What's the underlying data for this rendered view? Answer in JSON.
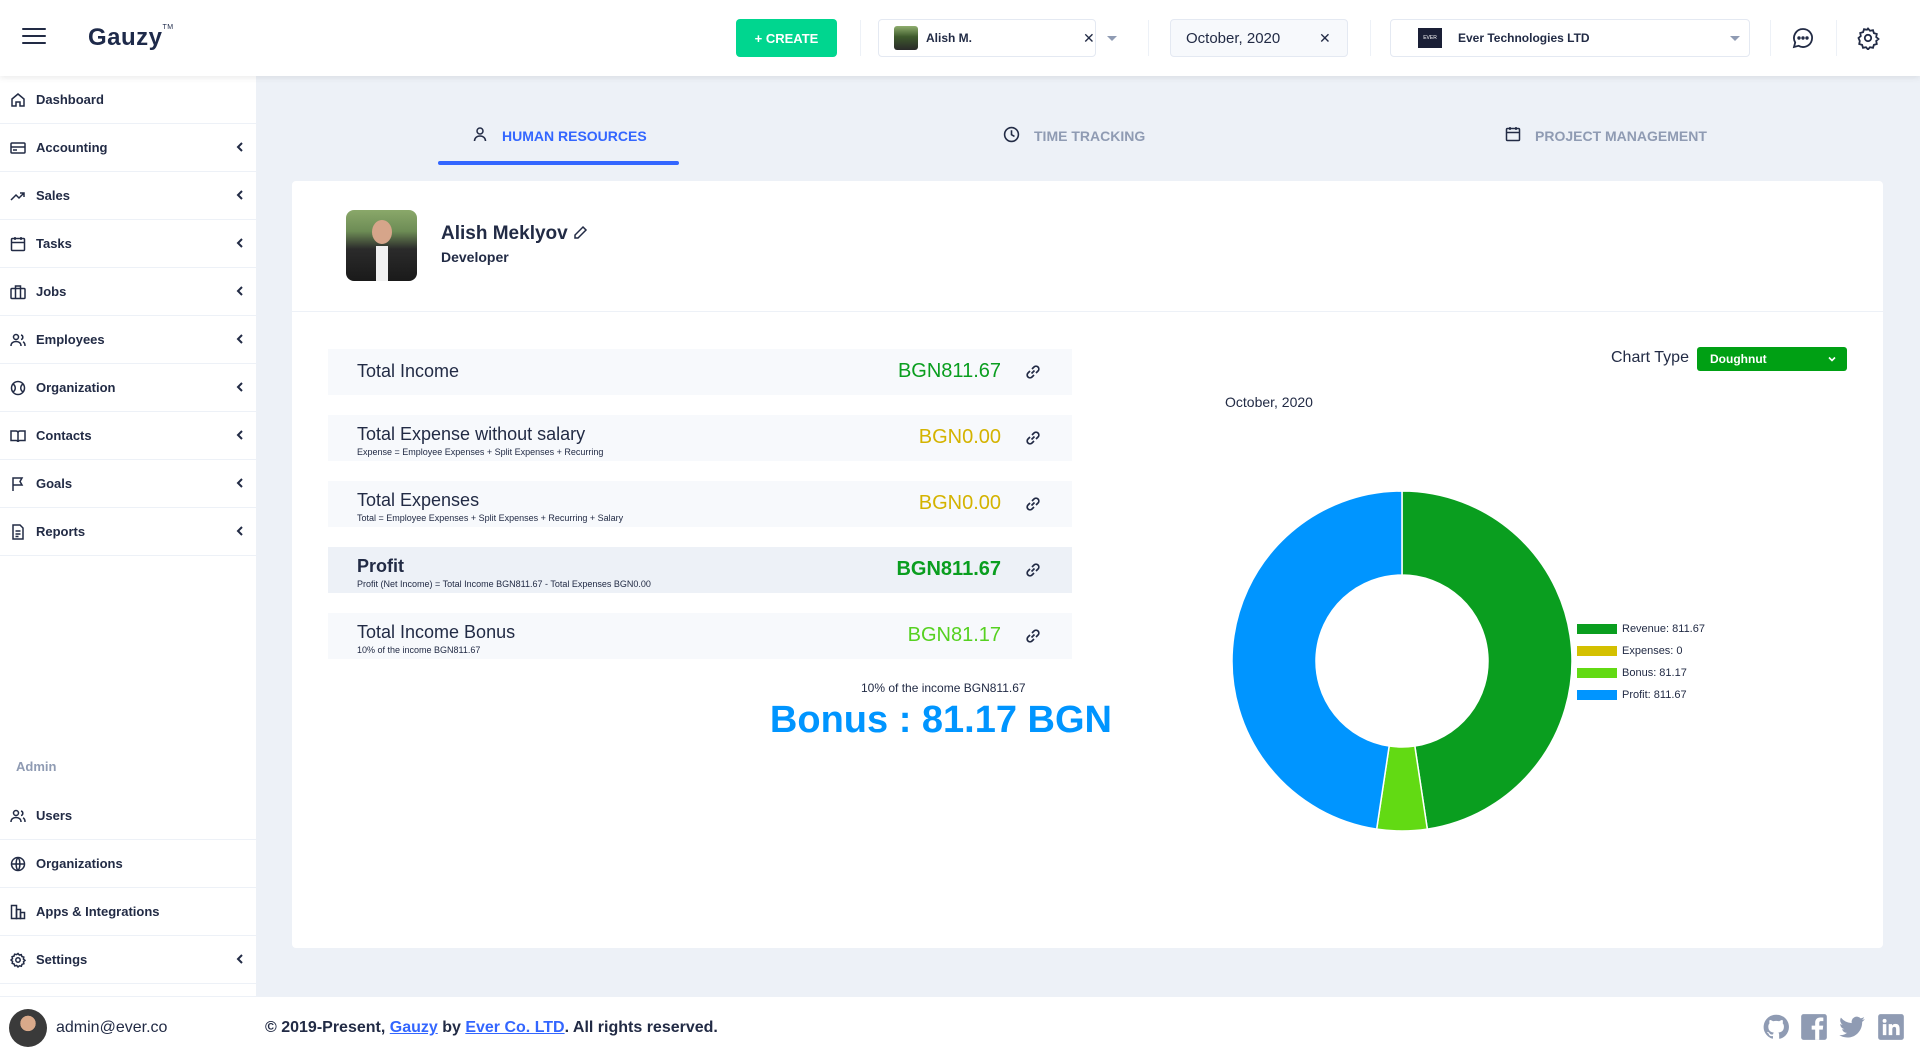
{
  "header": {
    "logo": "Gauzy",
    "logo_tm": "TM",
    "create_label": "+ CREATE",
    "employee": "Alish M.",
    "date": "October, 2020",
    "organization": "Ever Technologies LTD",
    "org_logo_text": "EVER"
  },
  "sidebar": {
    "items": [
      {
        "label": "Dashboard",
        "icon": "home-icon",
        "has_children": false
      },
      {
        "label": "Accounting",
        "icon": "credit-card-icon",
        "has_children": true
      },
      {
        "label": "Sales",
        "icon": "trending-up-icon",
        "has_children": true
      },
      {
        "label": "Tasks",
        "icon": "calendar-icon",
        "has_children": true
      },
      {
        "label": "Jobs",
        "icon": "briefcase-icon",
        "has_children": true
      },
      {
        "label": "Employees",
        "icon": "people-icon",
        "has_children": true
      },
      {
        "label": "Organization",
        "icon": "globe-icon",
        "has_children": true
      },
      {
        "label": "Contacts",
        "icon": "book-icon",
        "has_children": true
      },
      {
        "label": "Goals",
        "icon": "flag-icon",
        "has_children": true
      },
      {
        "label": "Reports",
        "icon": "file-text-icon",
        "has_children": true
      }
    ],
    "admin_label": "Admin",
    "admin_items": [
      {
        "label": "Users",
        "icon": "people-icon",
        "has_children": false
      },
      {
        "label": "Organizations",
        "icon": "globe-icon",
        "has_children": false
      },
      {
        "label": "Apps & Integrations",
        "icon": "layers-icon",
        "has_children": false
      },
      {
        "label": "Settings",
        "icon": "settings-icon",
        "has_children": true
      }
    ]
  },
  "tabs": [
    {
      "label": "HUMAN RESOURCES",
      "icon": "person-icon",
      "active": true
    },
    {
      "label": "TIME TRACKING",
      "icon": "clock-icon",
      "active": false
    },
    {
      "label": "PROJECT MANAGEMENT",
      "icon": "calendar-icon",
      "active": false
    }
  ],
  "profile": {
    "name": "Alish Meklyov",
    "role": "Developer"
  },
  "stats": [
    {
      "title": "Total Income",
      "subtitle": "",
      "value": "BGN811.67",
      "color": "#0a9e1f",
      "bold": false
    },
    {
      "title": "Total Expense without salary",
      "subtitle": "Expense = Employee Expenses + Split Expenses + Recurring",
      "value": "BGN0.00",
      "color": "#d4b300",
      "bold": false
    },
    {
      "title": "Total Expenses",
      "subtitle": "Total = Employee Expenses + Split Expenses + Recurring + Salary",
      "value": "BGN0.00",
      "color": "#d4b300",
      "bold": false
    },
    {
      "title": "Profit",
      "subtitle": "Profit (Net Income) = Total Income BGN811.67 - Total Expenses BGN0.00",
      "value": "BGN811.67",
      "color": "#0a9e1f",
      "bold": true
    },
    {
      "title": "Total Income Bonus",
      "subtitle": "10% of the income BGN811.67",
      "value": "BGN81.17",
      "color": "#56d121",
      "bold": false
    }
  ],
  "bonus": {
    "note": "10% of the income BGN811.67",
    "headline": "Bonus : 81.17 BGN"
  },
  "chart_controls": {
    "label": "Chart Type",
    "selected": "Doughnut"
  },
  "chart_data": {
    "type": "doughnut",
    "title": "October, 2020",
    "series": [
      {
        "name": "Revenue",
        "value": 811.67,
        "color": "#0a9e1f"
      },
      {
        "name": "Expenses",
        "value": 0,
        "color": "#d4c000"
      },
      {
        "name": "Bonus",
        "value": 81.17,
        "color": "#62da13"
      },
      {
        "name": "Profit",
        "value": 811.67,
        "color": "#0095ff"
      }
    ],
    "legend_position": "right"
  },
  "footer": {
    "email": "admin@ever.co",
    "copyright_prefix": "© 2019-Present, ",
    "gauzy_link": "Gauzy",
    "by": " by ",
    "ever_link": "Ever Co. LTD",
    "suffix": ". All rights reserved."
  }
}
